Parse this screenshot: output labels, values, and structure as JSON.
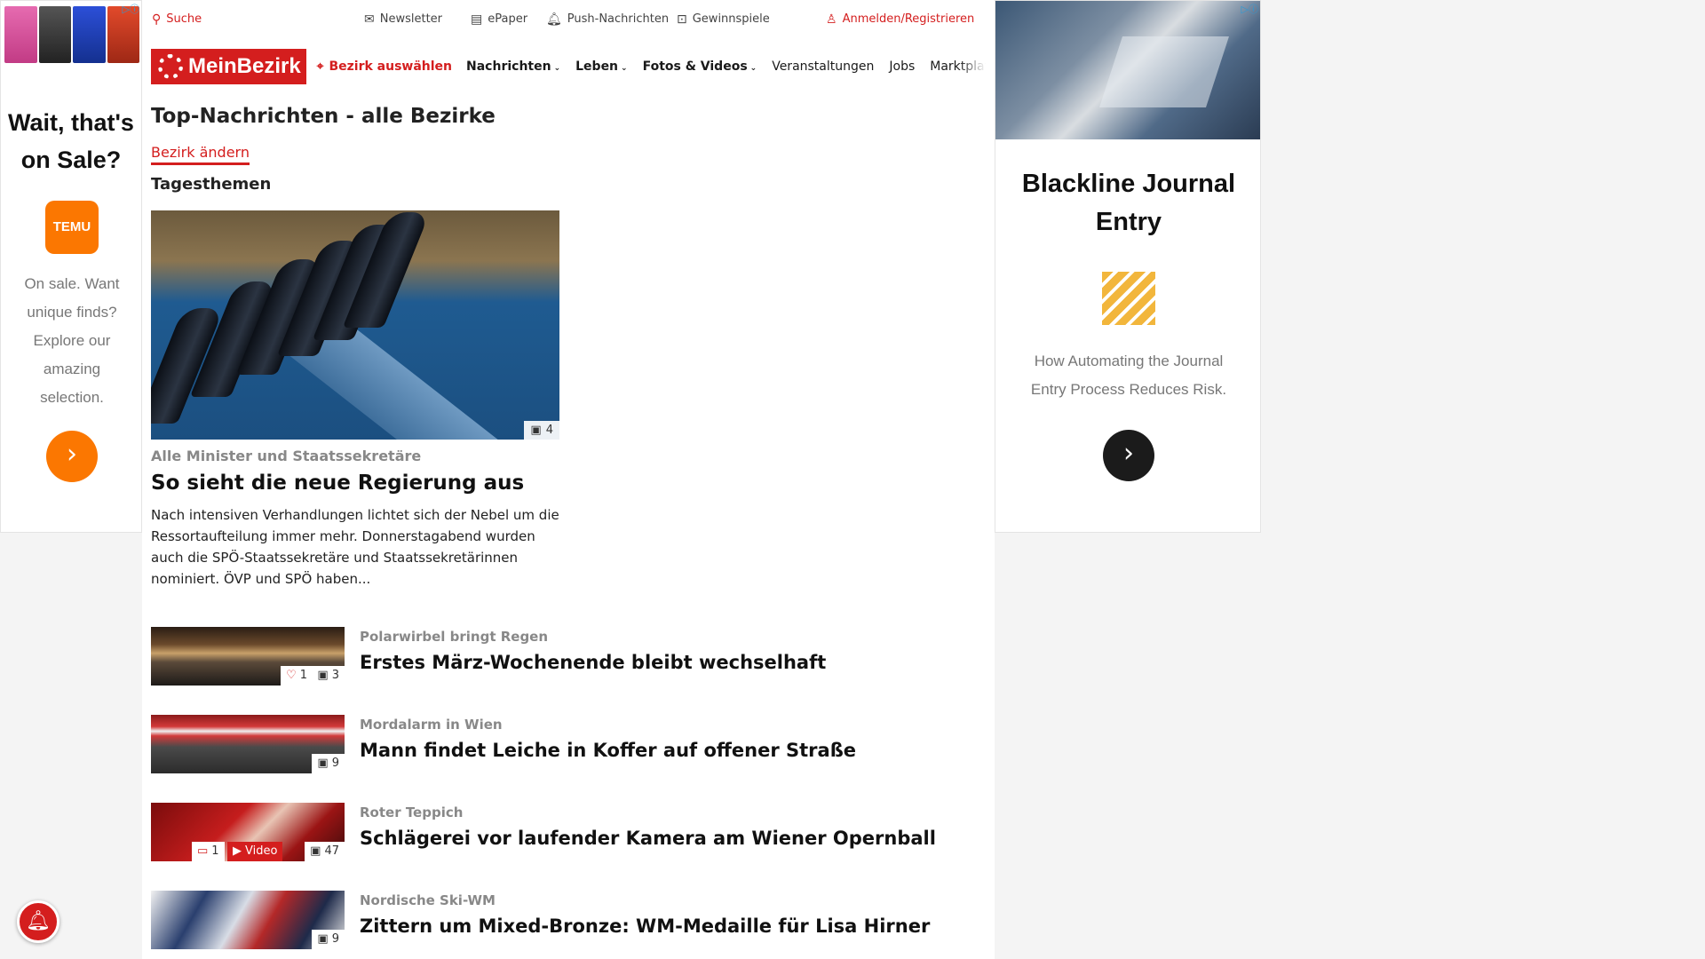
{
  "ads": {
    "left": {
      "headline": "Wait, that's on Sale?",
      "brand_logo_text": "TEMU",
      "body": "On sale. Want unique finds? Explore our amazing selection.",
      "cta_icon": "chevron-right-icon",
      "accent": "#fb7701"
    },
    "right": {
      "headline": "Blackline Journal Entry",
      "body": "How Automating the Journal Entry Process Reduces Risk.",
      "cta_icon": "chevron-right-icon"
    }
  },
  "topbar": {
    "search_label": "Suche",
    "newsletter_label": "Newsletter",
    "epaper_label": "ePaper",
    "push_label": "Push-Nachrichten",
    "contest_label": "Gewinnspiele",
    "login_label": "Anmelden/Registrieren"
  },
  "nav": {
    "logo_text": "MeinBezirk",
    "bezirk_select": "Bezirk auswählen",
    "items": [
      "Nachrichten",
      "Leben",
      "Fotos & Videos",
      "Veranstaltungen",
      "Jobs",
      "Marktplatz"
    ]
  },
  "page": {
    "title": "Top-Nachrichten - alle Bezirke",
    "change_bezirk": "Bezirk ändern",
    "section": "Tagesthemen"
  },
  "hero": {
    "image_count": "4",
    "kicker": "Alle Minister und Staatssekretäre",
    "title": "So sieht die neue Regierung aus",
    "teaser": "Nach intensiven Verhandlungen lichtet sich der Nebel um die Ressortaufteilung immer mehr. Donnerstagabend wurden auch die SPÖ-Staatssekretäre und Staatssekretärinnen nominiert. ÖVP und SPÖ haben..."
  },
  "news": [
    {
      "kicker": "Polarwirbel bringt Regen",
      "title": "Erstes März-Wochenende bleibt wechselhaft",
      "likes": "1",
      "images": "3"
    },
    {
      "kicker": "Mordalarm in Wien",
      "title": "Mann findet Leiche in Koffer auf offener Straße",
      "images": "9"
    },
    {
      "kicker": "Roter Teppich",
      "title": "Schlägerei vor laufender Kamera am Wiener Opernball",
      "comments": "1",
      "video": "Video",
      "images": "47"
    },
    {
      "kicker": "Nordische Ski-WM",
      "title": "Zittern um Mixed-Bronze: WM-Medaille für Lisa Hirner",
      "images": "9"
    }
  ],
  "colors": {
    "brand": "#d41e1e",
    "temu": "#fb7701",
    "blackline": "#f2b63c"
  }
}
